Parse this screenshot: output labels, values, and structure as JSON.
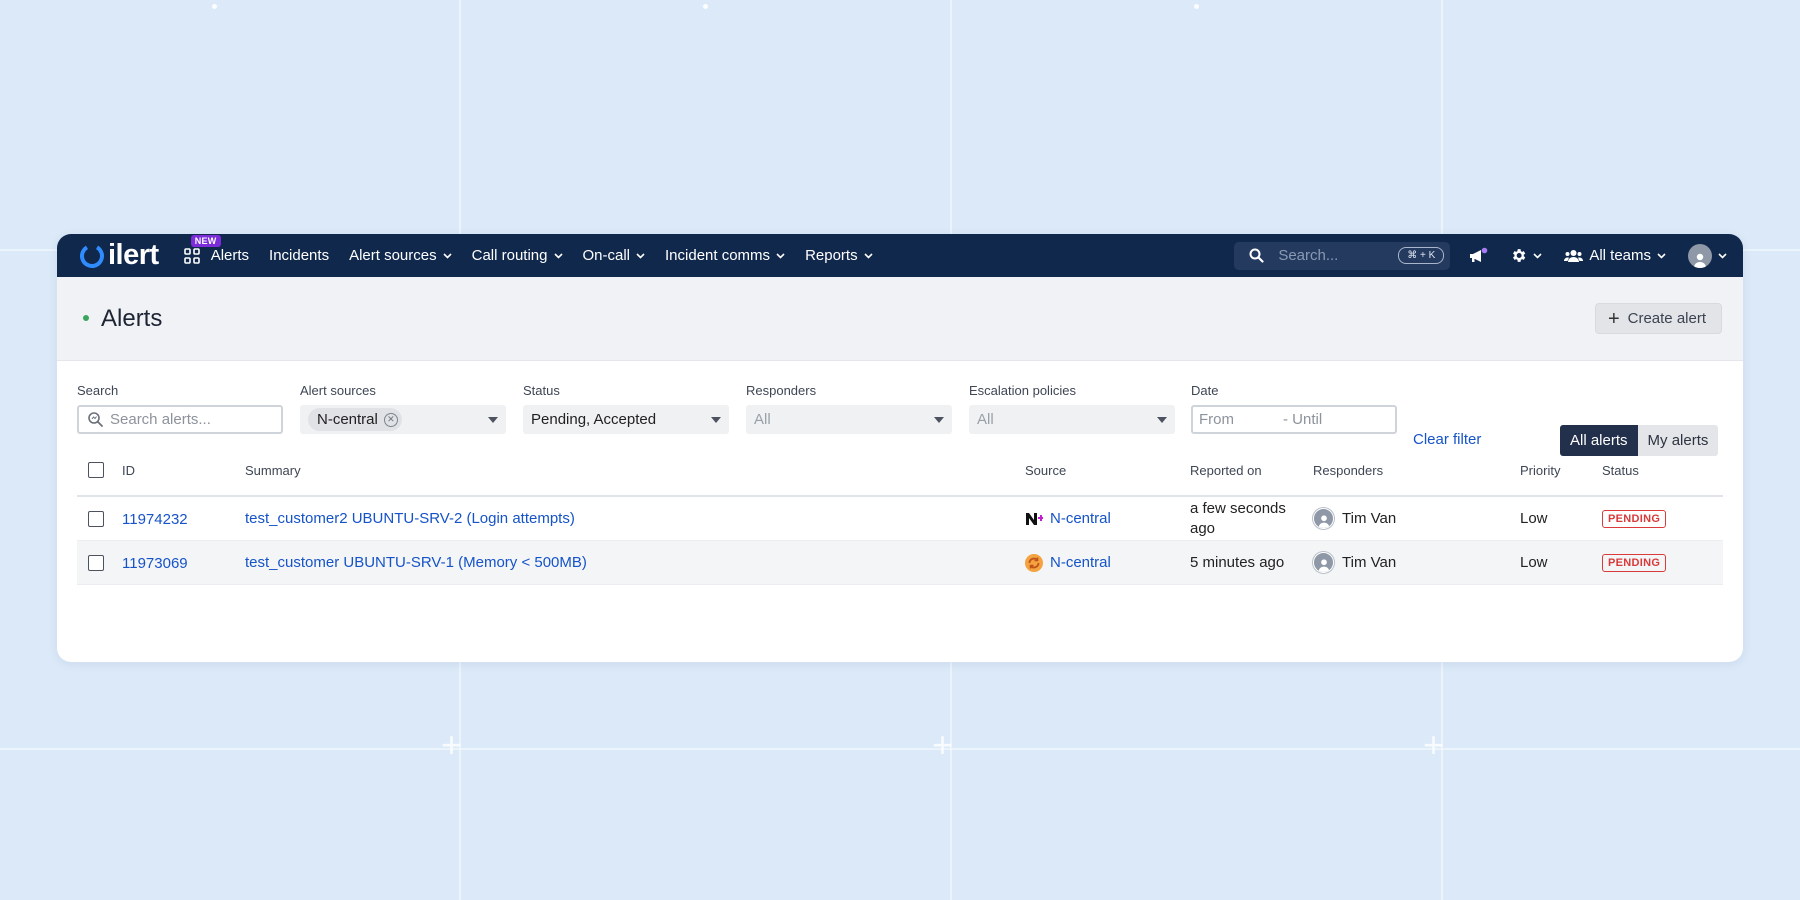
{
  "navbar": {
    "logo_text": "ilert",
    "new_badge": "NEW",
    "items": [
      {
        "label": "Alerts",
        "dropdown": false
      },
      {
        "label": "Incidents",
        "dropdown": false
      },
      {
        "label": "Alert sources",
        "dropdown": true
      },
      {
        "label": "Call routing",
        "dropdown": true
      },
      {
        "label": "On-call",
        "dropdown": true
      },
      {
        "label": "Incident comms",
        "dropdown": true
      },
      {
        "label": "Reports",
        "dropdown": true
      }
    ],
    "search_placeholder": "Search...",
    "search_shortcut": "⌘ + K",
    "teams_label": "All teams",
    "colors": {
      "background": "#11284d",
      "logo_accent": "#2f8cff",
      "badge": "#7c2cd9"
    }
  },
  "header": {
    "title": "Alerts",
    "create_button": "Create alert"
  },
  "filters": {
    "search": {
      "label": "Search",
      "placeholder": "Search alerts..."
    },
    "alert_sources": {
      "label": "Alert sources",
      "chip": "N-central"
    },
    "status": {
      "label": "Status",
      "value": "Pending, Accepted"
    },
    "responders": {
      "label": "Responders",
      "value": "All"
    },
    "escalation_policies": {
      "label": "Escalation policies",
      "value": "All"
    },
    "date": {
      "label": "Date",
      "from_placeholder": "From",
      "until_placeholder": "- Until"
    },
    "clear_filter": "Clear filter",
    "view_toggle": {
      "all": "All alerts",
      "mine": "My alerts",
      "selected": "All alerts"
    }
  },
  "table": {
    "columns": {
      "id": "ID",
      "summary": "Summary",
      "source": "Source",
      "reported_on": "Reported on",
      "responders": "Responders",
      "priority": "Priority",
      "status": "Status"
    },
    "rows": [
      {
        "id": "11974232",
        "summary": "test_customer2 UBUNTU-SRV-2 (Login attempts)",
        "source": "N-central",
        "source_icon": "n-central-logo-icon",
        "reported_line1": "a few seconds",
        "reported_line2": "ago",
        "responder": "Tim Van",
        "priority": "Low",
        "status": "PENDING"
      },
      {
        "id": "11973069",
        "summary": "test_customer UBUNTU-SRV-1 (Memory < 500MB)",
        "source": "N-central",
        "source_icon": "sync-orange-icon",
        "reported_line1": "5 minutes ago",
        "reported_line2": "",
        "responder": "Tim Van",
        "priority": "Low",
        "status": "PENDING"
      }
    ],
    "colors": {
      "link": "#1553c8",
      "pending": "#d93a3a"
    }
  }
}
